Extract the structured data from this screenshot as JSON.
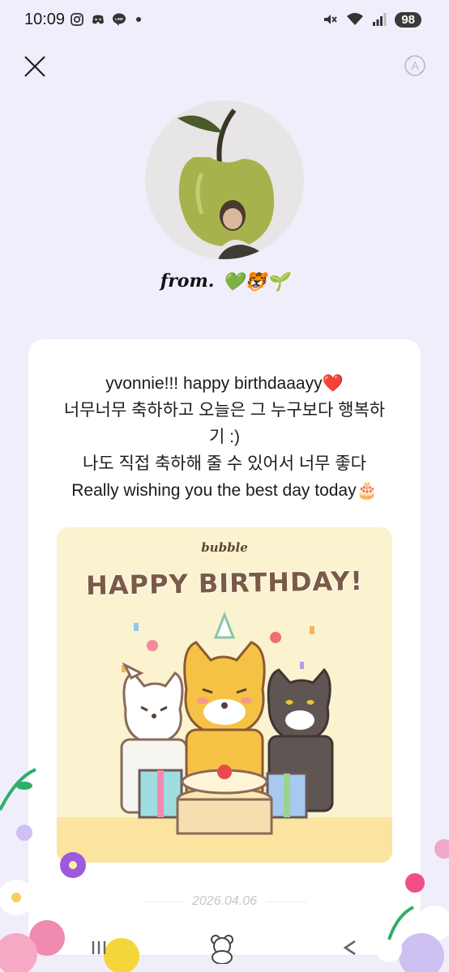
{
  "status": {
    "time": "10:09",
    "battery": "98"
  },
  "header": {
    "close_label": "close",
    "translate_label": "A"
  },
  "letter": {
    "from_label": "from.",
    "from_emojis": "💚🐯🌱",
    "lines": [
      "yvonnie!!! happy birthdaaayy❤️",
      "너무너무 축하하고 오늘은 그 누구보다 행복하",
      "기 :)",
      "나도 직접 축하해 줄 수 있어서 너무 좋다",
      "Really wishing you the best day today🎂"
    ],
    "card_image": {
      "brand": "bubble",
      "title": "HAPPY BIRTHDAY!"
    },
    "date": "2026.04.06"
  },
  "colors": {
    "background": "#f1eefb",
    "card": "#ffffff",
    "bday_bg": "#fbf2cf",
    "title_brown": "#7b5a46"
  }
}
